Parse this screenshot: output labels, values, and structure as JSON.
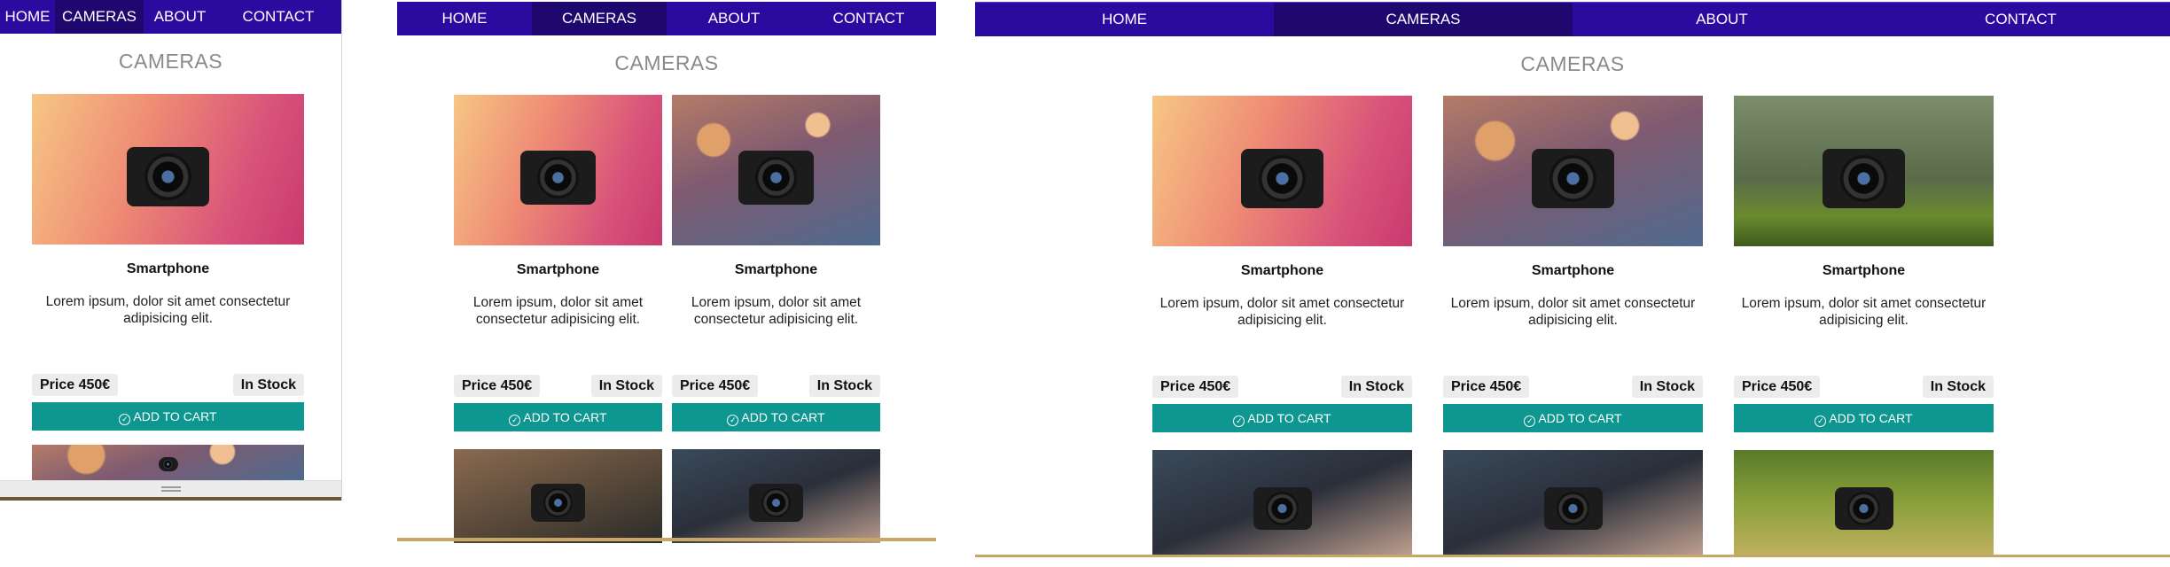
{
  "nav": {
    "items": [
      {
        "label": "HOME",
        "active": false
      },
      {
        "label": "CAMERAS",
        "active": true
      },
      {
        "label": "ABOUT",
        "active": false
      },
      {
        "label": "CONTACT",
        "active": false
      }
    ]
  },
  "page": {
    "title": "CAMERAS"
  },
  "product": {
    "name": "Smartphone",
    "description": "Lorem ipsum, dolor sit amet consectetur adipisicing elit.",
    "price": "Price 450€",
    "stock": "In Stock",
    "cart_label": "ADD TO CART",
    "cart_icon": "check-circle-icon"
  },
  "photos": [
    {
      "kind": "camera-in-hand-pink",
      "bg": "linear-gradient(110deg,#f6c684 0%,#ee8a74 40%,#d8537a 75%,#c93a6f 100%)"
    },
    {
      "kind": "camera-back-bokeh",
      "bg": "radial-gradient(circle at 20% 30%,#e0a06a 0 8%,transparent 9%),radial-gradient(circle at 70% 20%,#f0c090 0 6%,transparent 7%),linear-gradient(160deg,#b57b68 0%,#7e5a70 45%,#506a8e 100%)"
    },
    {
      "kind": "nikon-on-moss",
      "bg": "linear-gradient(180deg,#7b8d6a 0%,#5a6b4a 55%,#6a8a2e 80%,#3f5a1c 100%)"
    },
    {
      "kind": "nikon-closeup",
      "bg": "linear-gradient(160deg,#8a6a50 0%,#5a4a3a 50%,#2a2a2a 100%)"
    },
    {
      "kind": "two-cameras-dark",
      "bg": "linear-gradient(160deg,#3a4a5a 0%,#2a2f3a 50%,#c0a090 100%)"
    },
    {
      "kind": "woman-with-camera-sunflowers",
      "bg": "linear-gradient(180deg,#5a7a2a 0%,#8aa03a 50%,#c0b060 100%)"
    }
  ]
}
